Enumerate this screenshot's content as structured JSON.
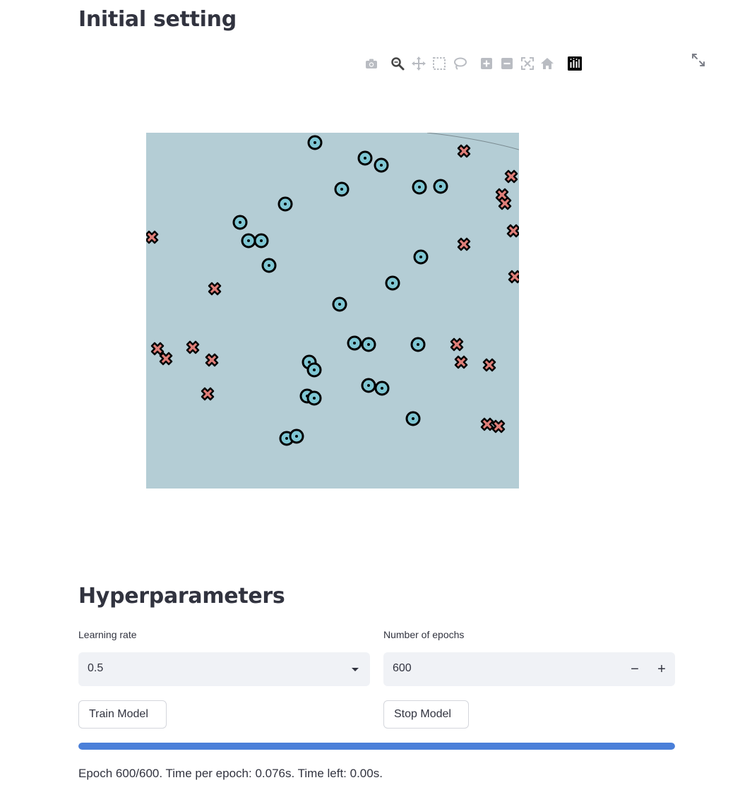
{
  "section_initial": {
    "title": "Initial setting"
  },
  "modebar": {
    "buttons": [
      "camera-icon",
      "zoom-icon",
      "pan-icon",
      "box-select-icon",
      "lasso-icon",
      "zoom-in-icon",
      "zoom-out-icon",
      "autoscale-icon",
      "reset-axes-icon",
      "plotly-logo-icon"
    ],
    "fullscreen_icon": "fullscreen-icon"
  },
  "chart_data": {
    "type": "scatter",
    "title": "",
    "xlabel": "",
    "ylabel": "",
    "xlim": [
      0,
      528
    ],
    "ylim": [
      0,
      504
    ],
    "background_color": "#b4cdd5",
    "decision_boundary_color": "#7a8a90",
    "series": [
      {
        "name": "",
        "marker": "circle-dot",
        "color": "#7fc6d3",
        "x": [
          214,
          240,
          286,
          352,
          239,
          310,
          333,
          387,
          277,
          417,
          197,
          133,
          145,
          163,
          174,
          389,
          349,
          274,
          295,
          315,
          385,
          231,
          238,
          315,
          228,
          238,
          334,
          378,
          199,
          213
        ],
        "y": [
          282,
          294,
          283,
          276,
          238,
          216,
          206,
          175,
          172,
          176,
          151,
          125,
          99,
          99,
          64,
          76,
          39,
          9,
          -46,
          -48,
          -48,
          -73,
          -84,
          -106,
          -121,
          -124,
          -110,
          -153,
          -181,
          -178
        ]
      },
      {
        "name": "",
        "marker": "x",
        "color": "#e07f79",
        "x": [
          88,
          92,
          450,
          517,
          504,
          508,
          520,
          8,
          450,
          522,
          97,
          16,
          28,
          66,
          93,
          440,
          446,
          486,
          87,
          483,
          499
        ],
        "y": [
          308,
          296,
          226,
          190,
          164,
          152,
          113,
          104,
          94,
          48,
          31,
          -54,
          -68,
          -52,
          -70,
          -48,
          -73,
          -77,
          -118,
          -161,
          -164
        ]
      }
    ]
  },
  "section_hyper": {
    "title": "Hyperparameters"
  },
  "learning_rate": {
    "label": "Learning rate",
    "value": "0.5"
  },
  "epochs": {
    "label": "Number of epochs",
    "value": "600",
    "minus": "−",
    "plus": "+"
  },
  "buttons": {
    "train": "Train Model",
    "stop": "Stop Model"
  },
  "progress": {
    "fraction": 1.0,
    "color": "#4a7fd9"
  },
  "status_text": "Epoch 600/600. Time per epoch: 0.076s. Time left: 0.00s."
}
